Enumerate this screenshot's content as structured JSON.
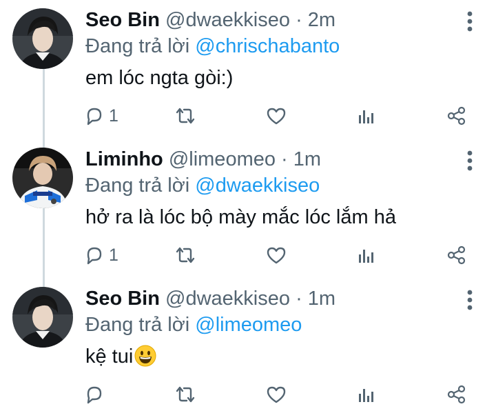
{
  "reply_prefix": "Đang trả lời",
  "dot": "·",
  "tweets": [
    {
      "name": "Seo Bin",
      "handle": "@dwaekkiseo",
      "time": "2m",
      "reply_to": "@chrischabanto",
      "text": "em lóc ngta gòi:)",
      "reply_count": "1",
      "avatar_icon": "avatar-photo"
    },
    {
      "name": "Liminho",
      "handle": "@limeomeo",
      "time": "1m",
      "reply_to": "@dwaekkiseo",
      "text": "hở ra là lóc bộ mày mắc lóc lắm hả",
      "reply_count": "1",
      "avatar_icon": "avatar-photo"
    },
    {
      "name": "Seo Bin",
      "handle": "@dwaekkiseo",
      "time": "1m",
      "reply_to": "@limeomeo",
      "text": "kệ tui",
      "text_emoji": "grinning-face-emoji",
      "reply_count": "",
      "avatar_icon": "avatar-photo"
    }
  ],
  "colors": {
    "text_primary": "#0f1419",
    "text_secondary": "#536471",
    "mention": "#1d9bf0",
    "thread_line": "#cfd9de"
  }
}
